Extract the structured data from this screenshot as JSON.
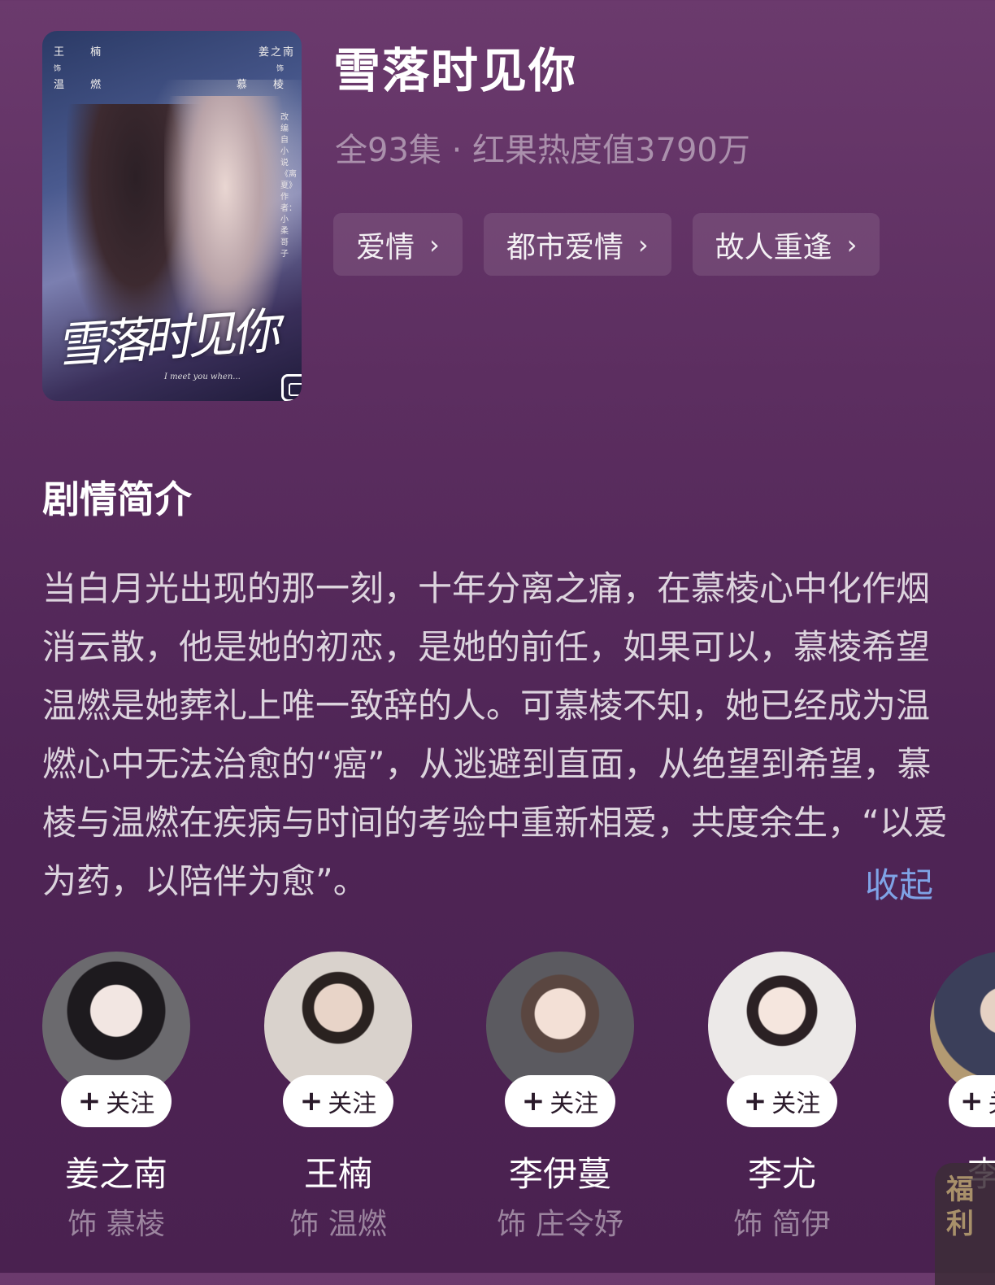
{
  "poster": {
    "credit_left": [
      "王 楠",
      "饰",
      "温 燃"
    ],
    "credit_right": [
      "姜之南",
      "饰",
      "慕 棱"
    ],
    "vertical_text": "改编自小说《离夏》作者：小柔哥子",
    "calligraphy_title": "雪落时见你",
    "english_subtitle": "I meet you when..."
  },
  "title": "雪落时见你",
  "meta": "全93集 · 红果热度值3790万",
  "tags": [
    {
      "label": "爱情"
    },
    {
      "label": "都市爱情"
    },
    {
      "label": "故人重逢"
    }
  ],
  "synopsis_section": {
    "heading": "剧情简介",
    "text": "当白月光出现的那一刻，十年分离之痛，在慕棱心中化作烟消云散，他是她的初恋，是她的前任，如果可以，慕棱希望温燃是她葬礼上唯一致辞的人。可慕棱不知，她已经成为温燃心中无法治愈的“癌”，从逃避到直面，从绝望到希望，慕棱与温燃在疾病与时间的考验中重新相爱，共度余生，“以爱为药，以陪伴为愈”。",
    "collapse_label": "收起"
  },
  "cast": [
    {
      "name": "姜之南",
      "role": "饰 慕棱",
      "follow": "关注"
    },
    {
      "name": "王楠",
      "role": "饰 温燃",
      "follow": "关注"
    },
    {
      "name": "李伊蔓",
      "role": "饰 庄令妤",
      "follow": "关注"
    },
    {
      "name": "李尤",
      "role": "饰 简伊",
      "follow": "关注"
    },
    {
      "name": "李",
      "role": "",
      "follow": "关"
    }
  ],
  "floating_badge": {
    "label_top": "福",
    "label_bottom": "利"
  },
  "colors": {
    "accent_link": "#7fa3e6",
    "background_top": "#6b3a6d",
    "background_bottom": "#4a2150"
  }
}
